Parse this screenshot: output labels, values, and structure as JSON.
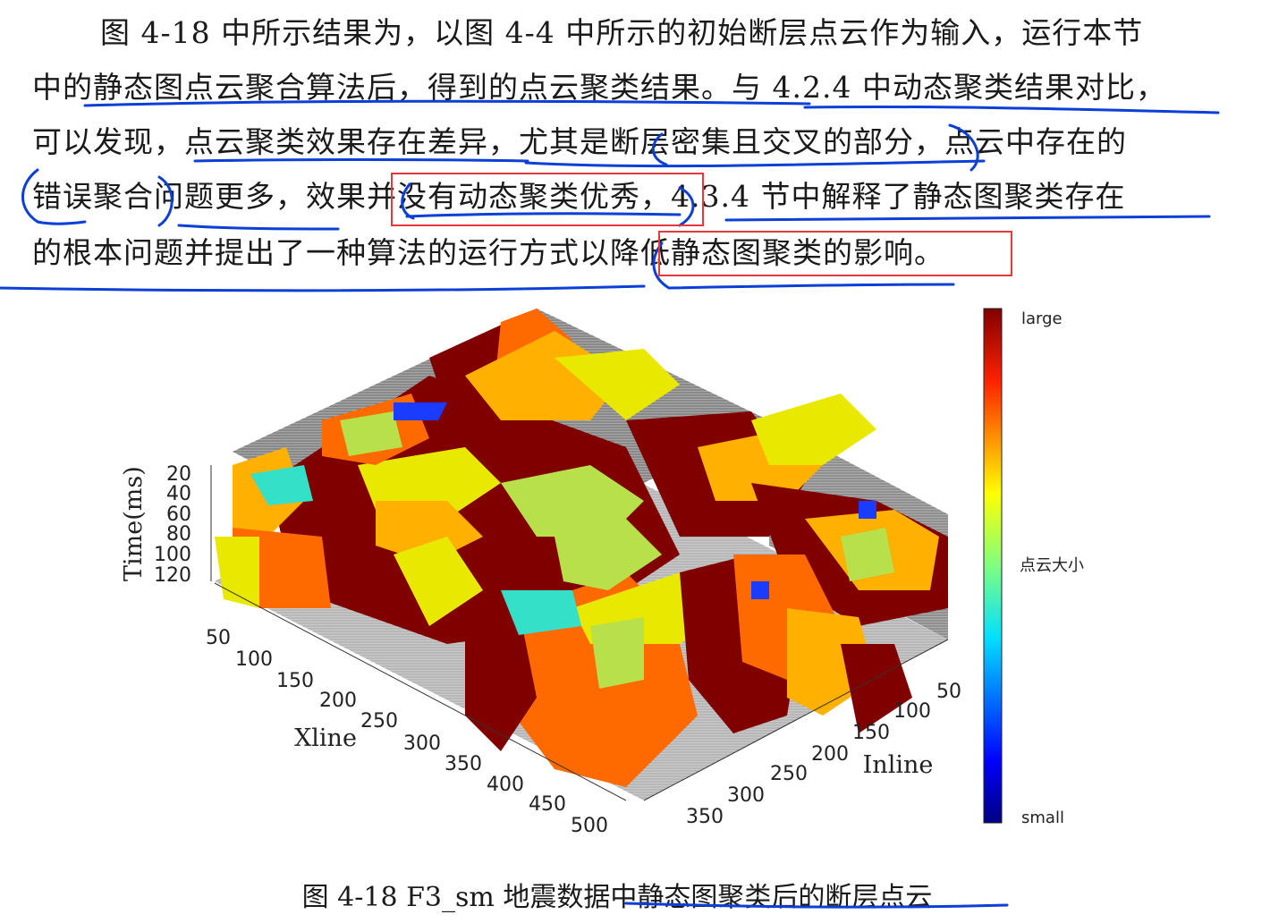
{
  "paragraph": {
    "line1": "图 4-18 中所示结果为，以图 4-4 中所示的初始断层点云作为输入，运行本节",
    "line2": "中的静态图点云聚合算法后，得到的点云聚类结果。与 4.2.4 中动态聚类结果对比，",
    "line3": "可以发现，点云聚类效果存在差异，尤其是断层密集且交叉的部分，点云中存在的",
    "line4": "错误聚合问题更多，效果并没有动态聚类优秀，4.3.4 节中解释了静态图聚类存在",
    "line5": "的根本问题并提出了一种算法的运行方式以降低静态图聚类的影响。"
  },
  "figure": {
    "z_axis_label": "Time(ms)",
    "x_axis_label": "Xline",
    "y_axis_label": "Inline",
    "z_ticks": [
      "20",
      "40",
      "60",
      "80",
      "100",
      "120"
    ],
    "x_ticks": [
      "50",
      "100",
      "150",
      "200",
      "250",
      "300",
      "350",
      "400",
      "450",
      "500"
    ],
    "y_ticks": [
      "50",
      "100",
      "150",
      "200",
      "250",
      "300",
      "350"
    ],
    "colorbar": {
      "top": "large",
      "middle": "点云大小",
      "bottom": "small"
    },
    "colors": {
      "dark_red": "#800000",
      "red": "#e01b00",
      "orange": "#ff6a00",
      "amber": "#ffb000",
      "yellow": "#e8e800",
      "lime": "#b8e04a",
      "cyan": "#35e0c8",
      "blue": "#1a3cff",
      "navy": "#000080",
      "seismic_gray": "#8a8a8a"
    }
  },
  "caption": "图 4-18 F3_sm 地震数据中静态图聚类后的断层点云"
}
